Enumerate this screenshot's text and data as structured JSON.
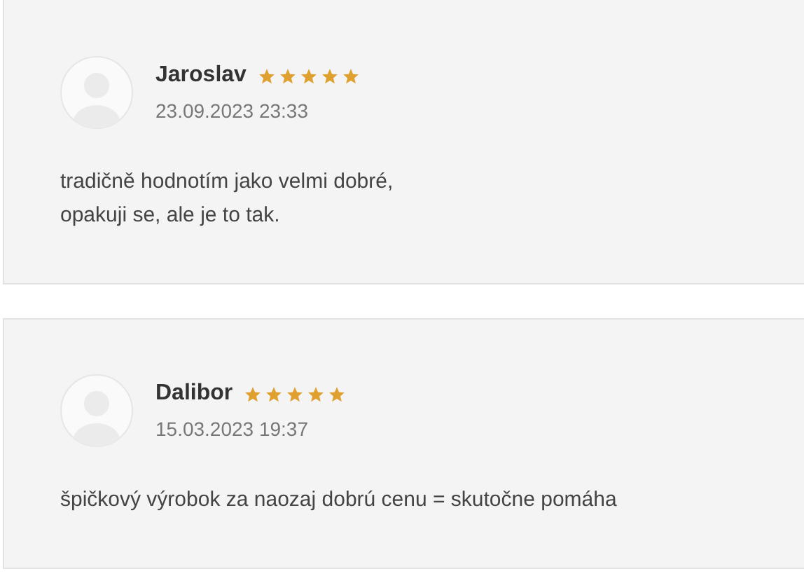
{
  "reviews": [
    {
      "author": "Jaroslav",
      "stars": 5,
      "date": "23.09.2023 23:33",
      "lines": [
        "tradičně hodnotím jako velmi dobré,",
        "opakuji se, ale je to tak."
      ]
    },
    {
      "author": "Dalibor",
      "stars": 5,
      "date": "15.03.2023 19:37",
      "lines": [
        "špičkový výrobok za naozaj dobrú cenu = skutočne pomáha"
      ]
    }
  ]
}
